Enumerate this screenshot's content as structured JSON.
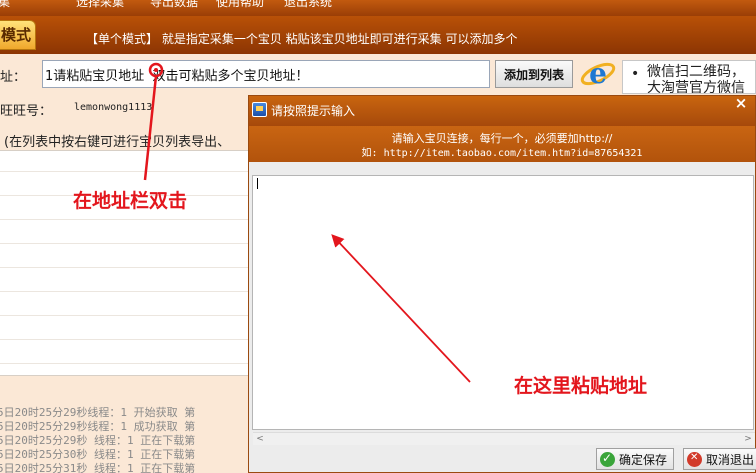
{
  "menubar": {
    "items": [
      "采集",
      "选择采集",
      "导出数据",
      "使用帮助",
      "退出系统"
    ]
  },
  "modebar": {
    "tab_label": "模式",
    "description": "【单个模式】 就是指定采集一个宝贝  粘贴该宝贝地址即可进行采集  可以添加多个"
  },
  "form": {
    "url_label": "址：",
    "url_value": "1请粘贴宝贝地址  双击可粘贴多个宝贝地址！",
    "add_button": "添加到列表",
    "wangwang_label": "旺旺号：",
    "wangwang_value": "lemonwong1113",
    "hint": "(在列表中按右键可进行宝贝列表导出、"
  },
  "wechat": {
    "line1": "微信扫二维码，",
    "line2": "大淘营官方微信"
  },
  "log": {
    "lines": [
      "5日20时25分29秒线程：1  开始获取 第",
      "5日20时25分29秒线程：1  成功获取 第",
      "5日20时25分29秒 线程：1  正在下载第",
      "5日20时25分30秒 线程：1  正在下载第",
      "5日20时25分31秒 线程：1  正在下载第"
    ]
  },
  "dialog": {
    "title": "请按照提示输入",
    "close": "×",
    "instruction_line1": "请输入宝贝连接，每行一个，必须要加http://",
    "instruction_line2": "如: http://item.taobao.com/item.htm?id=87654321",
    "save_button": "确定保存",
    "cancel_button": "取消退出"
  },
  "annotations": {
    "double_click": "在地址栏双击",
    "paste_here": "在这里粘贴地址",
    "color": "#e3161d"
  },
  "colors": {
    "brand_orange": "#b95107",
    "panel_bg": "#fbe8d6"
  }
}
